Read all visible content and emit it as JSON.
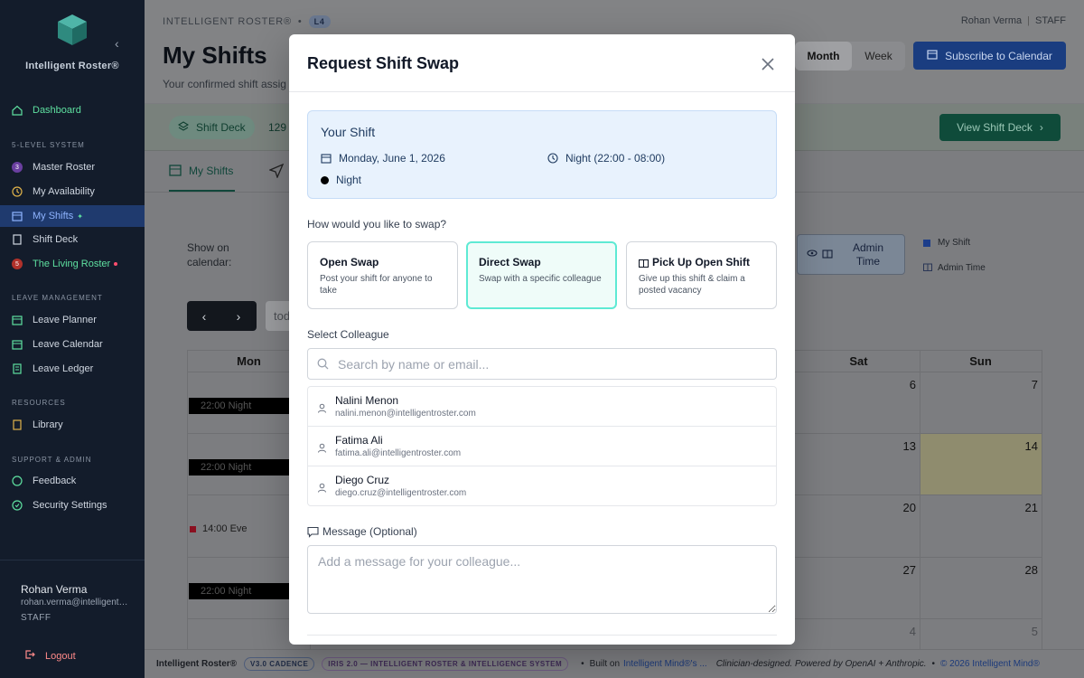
{
  "app": {
    "name": "Intelligent Roster®"
  },
  "sidebar": {
    "sections": {
      "five_level": "5-LEVEL SYSTEM",
      "leave": "LEAVE MANAGEMENT",
      "resources": "RESOURCES",
      "support": "SUPPORT & ADMIN"
    },
    "items": {
      "dashboard": "Dashboard",
      "master_roster": "Master Roster",
      "master_roster_badge": "3",
      "my_availability": "My Availability",
      "my_shifts": "My Shifts",
      "shift_deck": "Shift Deck",
      "living_roster": "The Living Roster",
      "living_roster_badge": "5",
      "leave_planner": "Leave Planner",
      "leave_calendar": "Leave Calendar",
      "leave_ledger": "Leave Ledger",
      "library": "Library",
      "feedback": "Feedback",
      "security_settings": "Security Settings"
    },
    "user": {
      "name": "Rohan Verma",
      "email": "rohan.verma@intelligentroster.com",
      "role": "STAFF"
    },
    "logout": "Logout"
  },
  "header": {
    "breadcrumb_app": "INTELLIGENT ROSTER®",
    "breadcrumb_level": "L4",
    "user_name": "Rohan Verma",
    "user_role": "STAFF",
    "title": "My Shifts",
    "subtitle": "Your confirmed shift assig",
    "view_month": "Month",
    "view_week": "Week",
    "subscribe": "Subscribe to Calendar"
  },
  "deck_bar": {
    "pill": "Shift Deck",
    "count": "129",
    "view_button": "View Shift Deck"
  },
  "tabs": {
    "my_shifts": "My Shifts"
  },
  "calendar": {
    "show_on": "Show on calendar:",
    "admin_time_btn": "Admin Time",
    "legend_my_shift": "My Shift",
    "legend_admin_time": "Admin Time",
    "today_placeholder": "tod",
    "headers": {
      "mon": "Mon",
      "sat": "Sat",
      "sun": "Sun"
    },
    "days": {
      "sat": [
        "6",
        "13",
        "20",
        "27",
        "4"
      ],
      "sun": [
        "7",
        "14",
        "21",
        "28",
        "5"
      ]
    },
    "shifts": {
      "night1": "22:00 Night",
      "night2": "22:00 Night",
      "eve": "14:00 Eve",
      "night3": "22:00 Night"
    }
  },
  "footer": {
    "brand": "Intelligent Roster®",
    "pill1": "V3.0 CADENCE",
    "pill2": "IRIS 2.0 — INTELLIGENT ROSTER & INTELLIGENCE SYSTEM",
    "built_on": "Built on",
    "built_link": "Intelligent Mind®'s ...",
    "clinician": "Clinician-designed. Powered by OpenAI + Anthropic.",
    "copyright": "© 2026 Intelligent Mind®"
  },
  "modal": {
    "title": "Request Shift Swap",
    "your_shift": {
      "title": "Your Shift",
      "date": "Monday, June 1, 2026",
      "time": "Night (22:00 - 08:00)",
      "type": "Night"
    },
    "question": "How would you like to swap?",
    "options": [
      {
        "title": "Open Swap",
        "desc": "Post your shift for anyone to take"
      },
      {
        "title": "Direct Swap",
        "desc": "Swap with a specific colleague"
      },
      {
        "title": "Pick Up Open Shift",
        "desc": "Give up this shift & claim a posted vacancy"
      }
    ],
    "select_colleague": "Select Colleague",
    "search_placeholder": "Search by name or email...",
    "colleagues": [
      {
        "name": "Nalini Menon",
        "email": "nalini.menon@intelligentroster.com"
      },
      {
        "name": "Fatima Ali",
        "email": "fatima.ali@intelligentroster.com"
      },
      {
        "name": "Diego Cruz",
        "email": "diego.cruz@intelligentroster.com"
      }
    ],
    "message_label": "Message (Optional)",
    "message_placeholder": "Add a message for your colleague..."
  },
  "colors": {
    "sidebar_bg": "#131c2b",
    "active_nav": "#1f3a6e",
    "accent_teal": "#5eead4",
    "primary_blue": "#1a3d80",
    "deck_green": "#0f4b3a"
  }
}
